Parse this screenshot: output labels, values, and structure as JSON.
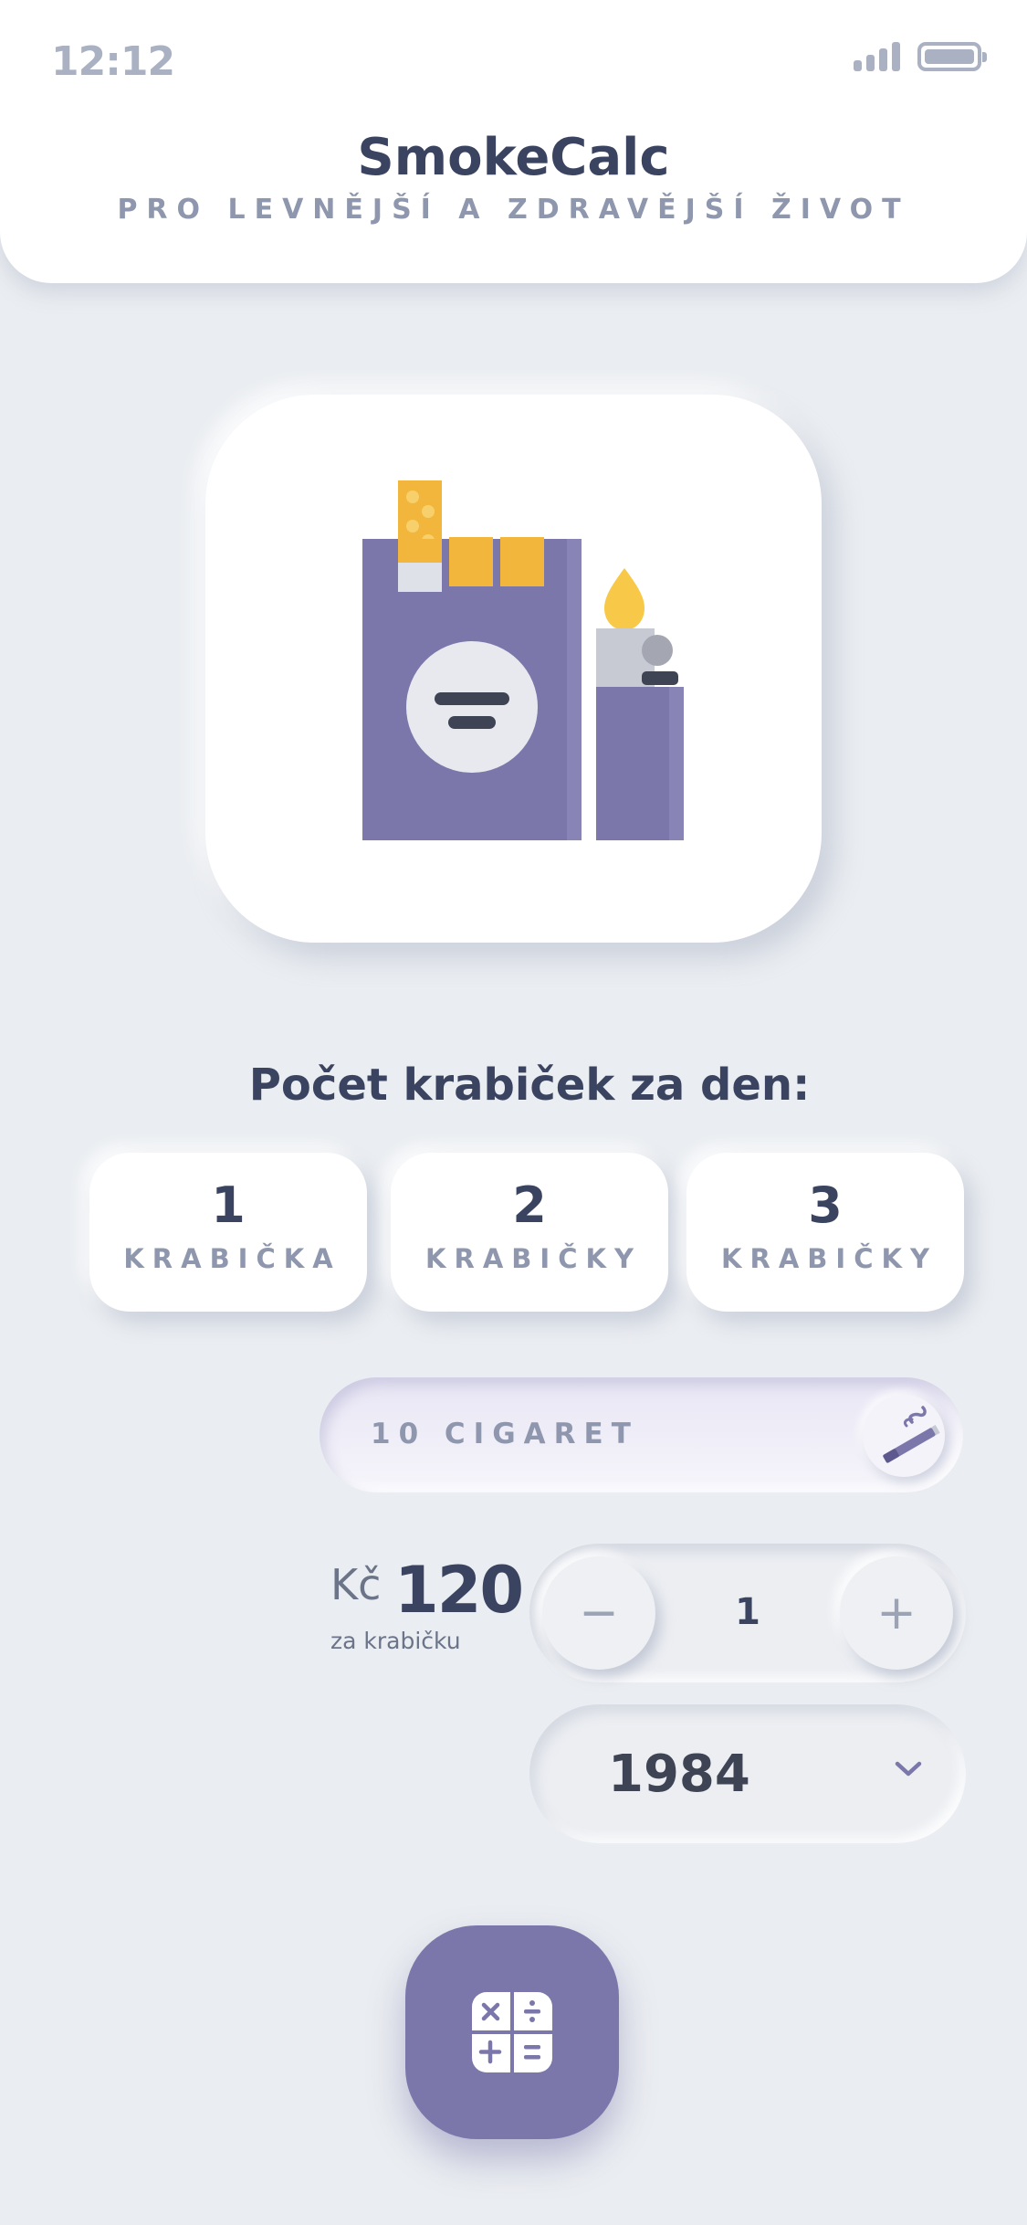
{
  "status_bar": {
    "time": "12:12",
    "signal_icon": "cellular-signal-icon",
    "battery_icon": "battery-icon"
  },
  "header": {
    "title": "SmokeCalc",
    "subtitle": "PRO LEVNĚJŠÍ A ZDRAVĚJŠÍ ŽIVOT"
  },
  "hero": {
    "illustration": "cigarette-pack-and-lighter-icon"
  },
  "packs": {
    "question": "Počet krabiček za den:",
    "options": [
      {
        "number": "1",
        "label": "KRABIČKA"
      },
      {
        "number": "2",
        "label": "KRABIČKY"
      },
      {
        "number": "3",
        "label": "KRABIČKY"
      }
    ]
  },
  "cigarettes": {
    "label": "10 CIGARET",
    "icon": "cigarette-icon"
  },
  "price": {
    "currency": "Kč",
    "value": "120",
    "caption": "za krabičku"
  },
  "stepper": {
    "minus": "−",
    "value": "1",
    "plus": "+"
  },
  "year": {
    "value": "1984",
    "icon": "chevron-down-icon"
  },
  "calculate": {
    "icon": "calculator-icon"
  },
  "colors": {
    "background": "#eaedf1",
    "primary": "#7b77ab",
    "accent": "#f2b63d",
    "text_dark": "#3a4460",
    "text_muted": "#8e97ad"
  }
}
